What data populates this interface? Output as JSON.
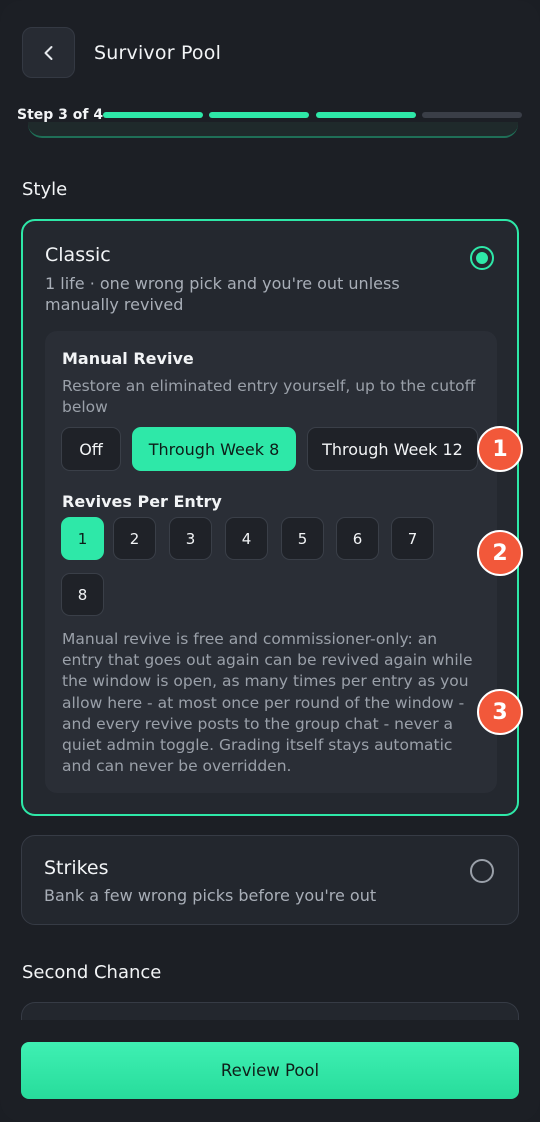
{
  "header": {
    "title": "Survivor Pool",
    "back_icon": "chevron-left-icon",
    "step_label": "Step 3 of 4",
    "progress": {
      "current_step": 3,
      "total_steps": 4
    }
  },
  "sections": {
    "style": "Style",
    "second_chance": "Second Chance"
  },
  "classic": {
    "title": "Classic",
    "description": "1 life · one wrong pick and you're out unless manually revived",
    "selected": true,
    "manual_revive": {
      "title": "Manual Revive",
      "description": "Restore an eliminated entry yourself, up to the cutoff below",
      "options": [
        "Off",
        "Through Week 8",
        "Through Week 12"
      ],
      "selected_option": "Through Week 8"
    },
    "revives_per_entry": {
      "title": "Revives Per Entry",
      "options": [
        "1",
        "2",
        "3",
        "4",
        "5",
        "6",
        "7",
        "8"
      ],
      "selected": "1"
    },
    "note": "Manual revive is free and commissioner-only: an entry that goes out again can be revived again while the window is open, as many times per entry as you allow here - at most once per round of the window - and every revive posts to the group chat - never a quiet admin toggle. Grading itself stays automatic and can never be overridden."
  },
  "strikes": {
    "title": "Strikes",
    "description": "Bank a few wrong picks before you're out",
    "selected": false
  },
  "markers": [
    "1",
    "2",
    "3"
  ],
  "footer": {
    "review_label": "Review Pool"
  },
  "colors": {
    "accent": "#2ee8a8",
    "background": "#1c1f25",
    "card": "#23272e",
    "marker": "#f2583a"
  }
}
